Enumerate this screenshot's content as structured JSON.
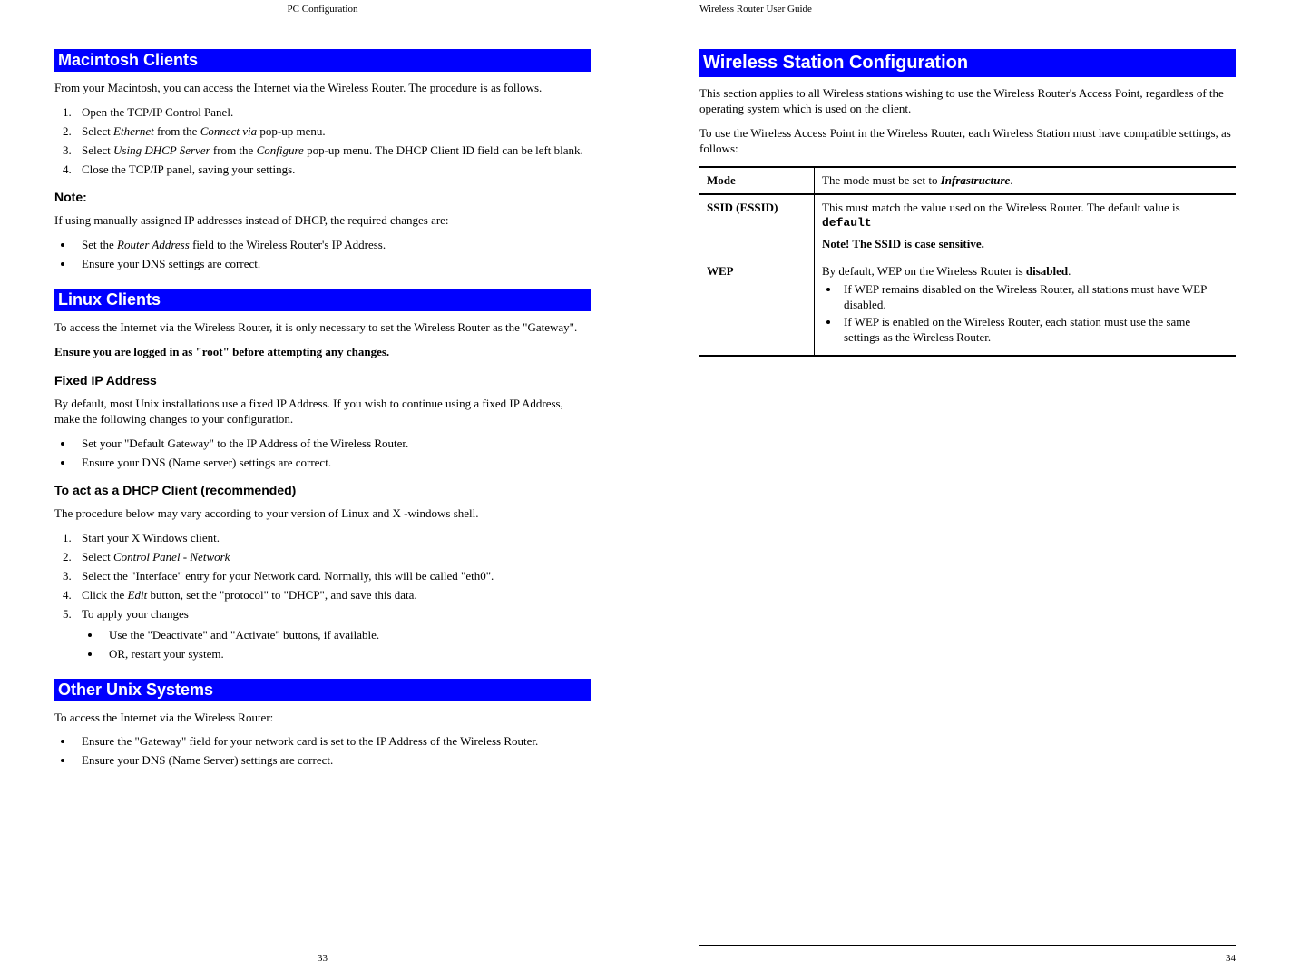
{
  "left": {
    "header": "PC Configuration",
    "page_number": "33",
    "mac": {
      "heading": "Macintosh Clients",
      "intro": "From your Macintosh, you can access the Internet via the Wireless Router. The procedure is as follows.",
      "steps": {
        "s1": "Open the TCP/IP Control Panel.",
        "s2a": "Select ",
        "s2b": "Ethernet",
        "s2c": " from the ",
        "s2d": "Connect via",
        "s2e": " pop-up menu.",
        "s3a": "Select ",
        "s3b": "Using DHCP Server",
        "s3c": " from the ",
        "s3d": "Configure",
        "s3e": " pop-up menu. The DHCP Client ID field can be left blank.",
        "s4": "Close the TCP/IP panel, saving your settings."
      },
      "note_heading": "Note:",
      "note_intro": "If using manually assigned IP addresses instead of DHCP, the required changes are:",
      "note_b1a": "Set the ",
      "note_b1b": "Router Address",
      "note_b1c": " field to the Wireless Router's IP Address.",
      "note_b2": "Ensure your DNS settings are correct."
    },
    "linux": {
      "heading": "Linux Clients",
      "intro": "To access the Internet via the Wireless Router, it is only necessary to set the Wireless Router as the \"Gateway\".",
      "warn": "Ensure you are logged in as \"root\" before attempting any changes.",
      "fixed_heading": "Fixed IP Address",
      "fixed_intro": "By default, most Unix installations use a fixed IP Address. If you wish to continue using a fixed IP Address, make the following changes to your configuration.",
      "fixed_b1": "Set your \"Default Gateway\" to the IP Address of the Wireless Router.",
      "fixed_b2": "Ensure your DNS (Name server) settings are correct.",
      "dhcp_heading": "To act as a DHCP Client (recommended)",
      "dhcp_intro": "The procedure below may vary according to your version of Linux and X -windows shell.",
      "d1": "Start your X Windows client.",
      "d2a": "Select ",
      "d2b": "Control Panel - Network",
      "d3": "Select the \"Interface\" entry for your Network card. Normally, this will be called \"eth0\".",
      "d4a": "Click the ",
      "d4b": "Edit",
      "d4c": " button, set the \"protocol\" to \"DHCP\", and save this data.",
      "d5": "To apply your changes",
      "d5a": "Use the \"Deactivate\" and \"Activate\" buttons, if available.",
      "d5b": "OR, restart your system."
    },
    "unix": {
      "heading": "Other Unix Systems",
      "intro": "To access the Internet via the Wireless Router:",
      "b1": "Ensure the \"Gateway\" field for your network card is set to the IP Address of the Wireless Router.",
      "b2": "Ensure your DNS (Name Server) settings are correct."
    }
  },
  "right": {
    "header": "Wireless Router User Guide",
    "page_number": "34",
    "wsc": {
      "heading": "Wireless Station Configuration",
      "p1": "This section applies to all Wireless stations wishing to use the Wireless Router's Access Point, regardless of the operating system which is used on the client.",
      "p2": "To use the Wireless Access Point in the Wireless Router, each Wireless Station must have compatible settings, as follows:",
      "table": {
        "mode_label": "Mode",
        "mode_a": "The mode must be set to ",
        "mode_b": "Infrastructure",
        "mode_c": ".",
        "ssid_label": "SSID (ESSID)",
        "ssid_a": "This must match the value used on the Wireless Router. The default value is ",
        "ssid_b": "default",
        "ssid_note": "Note! The SSID is case sensitive.",
        "wep_label": "WEP",
        "wep_a": "By default, WEP on the Wireless Router is ",
        "wep_b": "disabled",
        "wep_c": ".",
        "wep_li1": "If WEP remains disabled on the Wireless Router, all stations must have WEP disabled.",
        "wep_li2": "If WEP is enabled on the Wireless Router, each station must use the same settings as the Wireless Router."
      }
    }
  }
}
